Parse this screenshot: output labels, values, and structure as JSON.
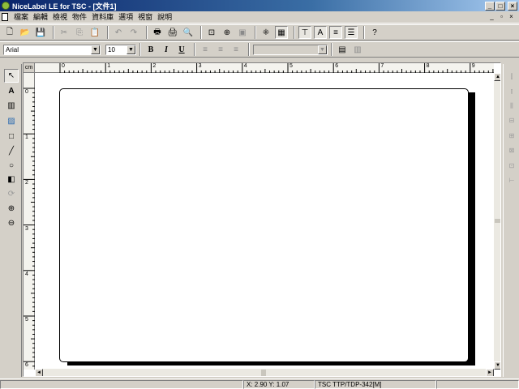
{
  "window": {
    "title": "NiceLabel LE for TSC - [文件1]",
    "minimize_glyph": "_",
    "maximize_glyph": "□",
    "close_glyph": "×"
  },
  "menu": {
    "items": [
      "檔案",
      "編輯",
      "檢視",
      "物件",
      "資料庫",
      "選項",
      "視窗",
      "說明"
    ],
    "mdi_minimize": "_",
    "mdi_restore": "▫",
    "mdi_close": "×"
  },
  "toolbar1": {
    "icons": {
      "new": "🗋",
      "open": "📂",
      "save": "💾",
      "cut": "✂",
      "copy": "⎘",
      "paste": "📋",
      "undo": "↶",
      "redo": "↷",
      "print": "🖶",
      "print_setup": "🖨",
      "preview": "🔍",
      "zoom_page": "⊡",
      "zoom_in": "⊕",
      "zoom_tool": "▣",
      "snap": "⁜",
      "grid": "▦",
      "align_top": "⊤",
      "text_align": "A",
      "center": "≡",
      "spacing": "☰",
      "help": "?"
    }
  },
  "toolbar2": {
    "font_name": "Arial",
    "font_size": "10",
    "bold": "B",
    "italic": "I",
    "underline": "U",
    "align_left": "≡",
    "align_center": "≡",
    "align_right": "≡",
    "variable_combo": "",
    "var_icon1": "▤",
    "var_icon2": "▥"
  },
  "tools": {
    "pointer": "↖",
    "text": "A",
    "barcode": "▥",
    "picture": "▨",
    "rectangle": "□",
    "line": "╱",
    "ellipse": "○",
    "reverse": "◧",
    "rotate": "⟳",
    "zoom_in": "⊕",
    "zoom_out": "⊖"
  },
  "align_tools": [
    "⫿",
    "⫾",
    "⫼",
    "⊟",
    "⊞",
    "⊠",
    "⊡",
    "⊢"
  ],
  "ruler": {
    "unit": "cm",
    "h_labels": [
      "0",
      "1",
      "2",
      "3",
      "4",
      "5",
      "6",
      "7",
      "8",
      "9"
    ],
    "v_labels": [
      "0",
      "1",
      "2",
      "3",
      "4",
      "5",
      "6"
    ]
  },
  "scroll": {
    "up": "▲",
    "down": "▼",
    "left": "◄",
    "right": "►"
  },
  "status": {
    "empty": "",
    "coords": "X: 2.90 Y: 1.07",
    "printer": "TSC TTP/TDP-342[M]"
  }
}
